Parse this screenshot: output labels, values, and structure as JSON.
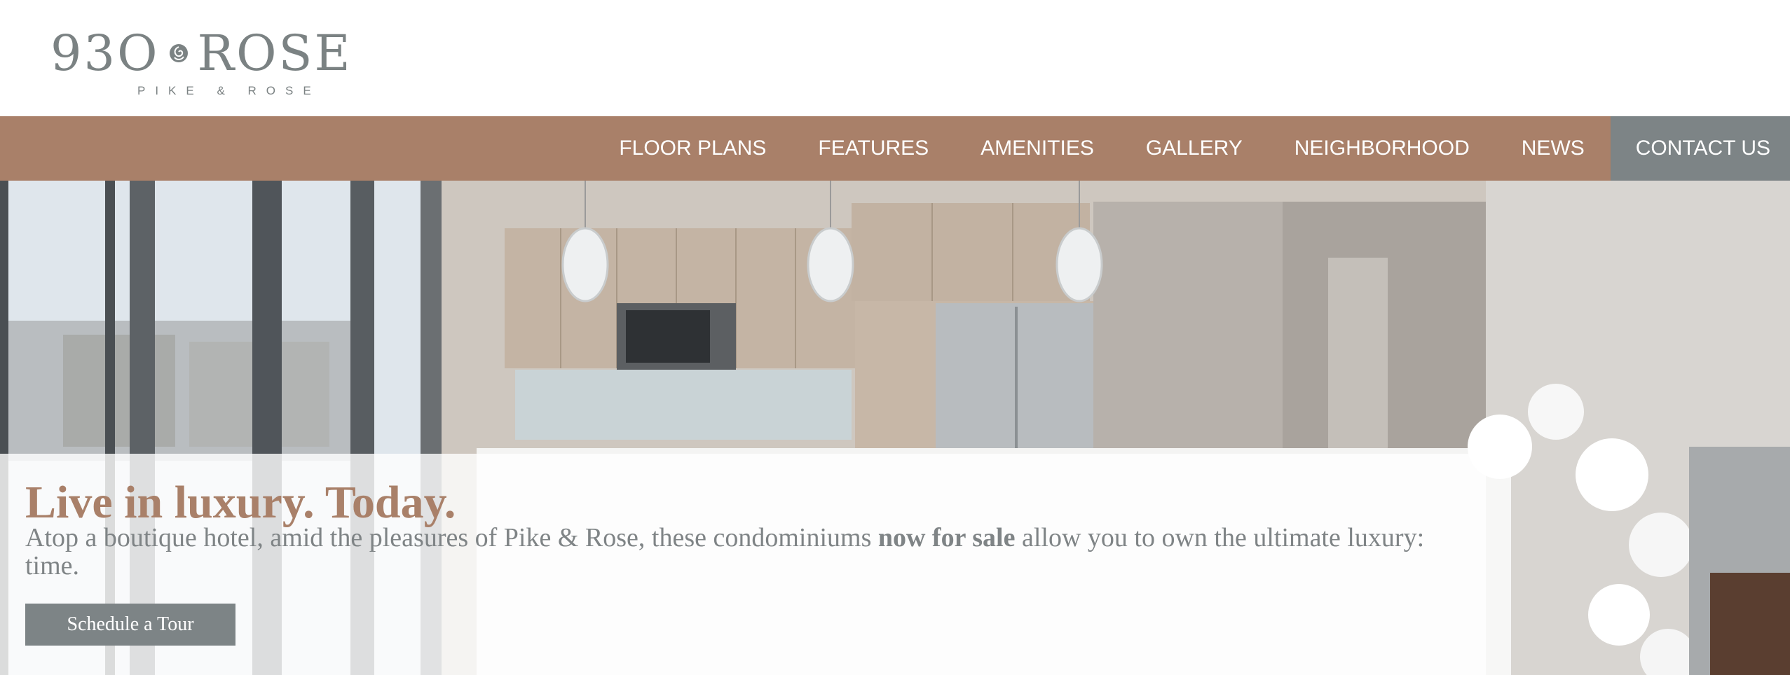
{
  "brand": {
    "logo_main_left": "93",
    "logo_main_right": "ROSE",
    "logo_tagline": "PIKE & ROSE",
    "logo_icon": "rose-icon"
  },
  "nav": {
    "items": [
      {
        "label": "FLOOR PLANS"
      },
      {
        "label": "FEATURES"
      },
      {
        "label": "AMENITIES"
      },
      {
        "label": "GALLERY"
      },
      {
        "label": "NEIGHBORHOOD"
      },
      {
        "label": "NEWS"
      },
      {
        "label": "CONTACT US"
      }
    ]
  },
  "hero": {
    "headline": "Live in luxury. Today.",
    "tagline_before": "Atop a boutique hotel, amid the pleasures of Pike & Rose, these condominiums ",
    "tagline_bold": "now for sale",
    "tagline_after": " allow you to own the ultimate luxury: time.",
    "cta_label": "Schedule a Tour"
  },
  "colors": {
    "brand_copper": "#a98069",
    "brand_gray": "#7d8486",
    "white": "#ffffff"
  }
}
